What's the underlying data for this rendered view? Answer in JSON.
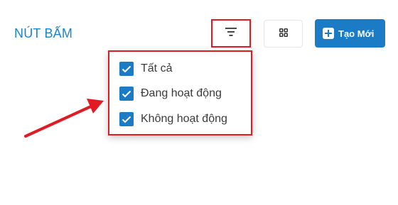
{
  "header": {
    "title": "NÚT BẤM",
    "filter_icon": "filter-lines-icon",
    "grid_icon": "grid-view-icon",
    "create_label": "Tạo Mới",
    "create_icon": "plus-square-icon"
  },
  "filter_menu": {
    "options": [
      {
        "label": "Tất cả",
        "checked": true
      },
      {
        "label": "Đang hoạt động",
        "checked": true
      },
      {
        "label": "Không hoạt động",
        "checked": true
      }
    ]
  },
  "colors": {
    "accent": "#1b7bc4",
    "title": "#1b86c7",
    "highlight": "#e01b24"
  }
}
